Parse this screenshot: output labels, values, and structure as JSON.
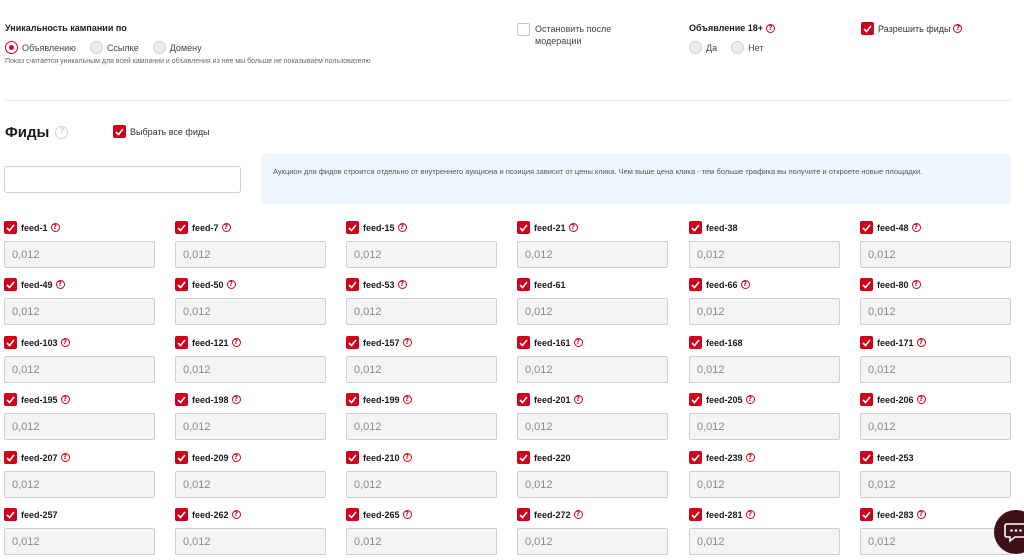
{
  "uniqueness": {
    "title": "Уникальность кампании по",
    "options": [
      "Объявлению",
      "Ссылке",
      "Домену"
    ],
    "selected": "Объявлению",
    "note": "Показ считается уникальным для всей кампании и объявления из нее мы больше не показываем пользователю"
  },
  "stop_after_moderation": {
    "label": "Остановить после модерации",
    "checked": false
  },
  "adult": {
    "title": "Объявление 18+",
    "options": [
      "Да",
      "Нет"
    ],
    "selected": null
  },
  "allow_feeds": {
    "label": "Разрешить фиды",
    "checked": true
  },
  "feeds": {
    "title": "Фиды",
    "select_all_label": "Выбрать все фиды",
    "select_all_checked": true,
    "search_value": "",
    "info": "Аукцион для фидов строится отдельно от внутреннего аукциона и позиция зависит от цены клика. Чем выше цена клика - тем больше трафика вы получите и откроете новые площадки.",
    "items": [
      {
        "name": "feed-1",
        "value": "0,012",
        "help": true,
        "checked": true
      },
      {
        "name": "feed-7",
        "value": "0,012",
        "help": true,
        "checked": true
      },
      {
        "name": "feed-15",
        "value": "0,012",
        "help": true,
        "checked": true
      },
      {
        "name": "feed-21",
        "value": "0,012",
        "help": true,
        "checked": true
      },
      {
        "name": "feed-38",
        "value": "0,012",
        "help": false,
        "checked": true
      },
      {
        "name": "feed-48",
        "value": "0,012",
        "help": true,
        "checked": true
      },
      {
        "name": "feed-49",
        "value": "0,012",
        "help": true,
        "checked": true
      },
      {
        "name": "feed-50",
        "value": "0,012",
        "help": true,
        "checked": true
      },
      {
        "name": "feed-53",
        "value": "0,012",
        "help": true,
        "checked": true
      },
      {
        "name": "feed-61",
        "value": "0,012",
        "help": false,
        "checked": true
      },
      {
        "name": "feed-66",
        "value": "0,012",
        "help": true,
        "checked": true
      },
      {
        "name": "feed-80",
        "value": "0,012",
        "help": true,
        "checked": true
      },
      {
        "name": "feed-103",
        "value": "0,012",
        "help": true,
        "checked": true
      },
      {
        "name": "feed-121",
        "value": "0,012",
        "help": true,
        "checked": true
      },
      {
        "name": "feed-157",
        "value": "0,012",
        "help": true,
        "checked": true
      },
      {
        "name": "feed-161",
        "value": "0,012",
        "help": true,
        "checked": true
      },
      {
        "name": "feed-168",
        "value": "0,012",
        "help": false,
        "checked": true
      },
      {
        "name": "feed-171",
        "value": "0,012",
        "help": true,
        "checked": true
      },
      {
        "name": "feed-195",
        "value": "0,012",
        "help": true,
        "checked": true
      },
      {
        "name": "feed-198",
        "value": "0,012",
        "help": true,
        "checked": true
      },
      {
        "name": "feed-199",
        "value": "0,012",
        "help": true,
        "checked": true
      },
      {
        "name": "feed-201",
        "value": "0,012",
        "help": true,
        "checked": true
      },
      {
        "name": "feed-205",
        "value": "0,012",
        "help": true,
        "checked": true
      },
      {
        "name": "feed-206",
        "value": "0,012",
        "help": true,
        "checked": true
      },
      {
        "name": "feed-207",
        "value": "0,012",
        "help": true,
        "checked": true
      },
      {
        "name": "feed-209",
        "value": "0,012",
        "help": true,
        "checked": true
      },
      {
        "name": "feed-210",
        "value": "0,012",
        "help": true,
        "checked": true
      },
      {
        "name": "feed-220",
        "value": "0,012",
        "help": false,
        "checked": true
      },
      {
        "name": "feed-239",
        "value": "0,012",
        "help": true,
        "checked": true
      },
      {
        "name": "feed-253",
        "value": "0,012",
        "help": false,
        "checked": true
      },
      {
        "name": "feed-257",
        "value": "0,012",
        "help": false,
        "checked": true
      },
      {
        "name": "feed-262",
        "value": "0,012",
        "help": true,
        "checked": true
      },
      {
        "name": "feed-265",
        "value": "0,012",
        "help": true,
        "checked": true
      },
      {
        "name": "feed-272",
        "value": "0,012",
        "help": true,
        "checked": true
      },
      {
        "name": "feed-281",
        "value": "0,012",
        "help": true,
        "checked": true
      },
      {
        "name": "feed-283",
        "value": "0,012",
        "help": true,
        "checked": true
      }
    ]
  },
  "icons": {
    "help": "question-circle-icon",
    "check": "checkmark-icon",
    "chat": "chat-bubble-icon"
  },
  "colors": {
    "accent": "#d0021b",
    "info_bg": "#eef7fd",
    "chat_bg": "#3f1018"
  }
}
